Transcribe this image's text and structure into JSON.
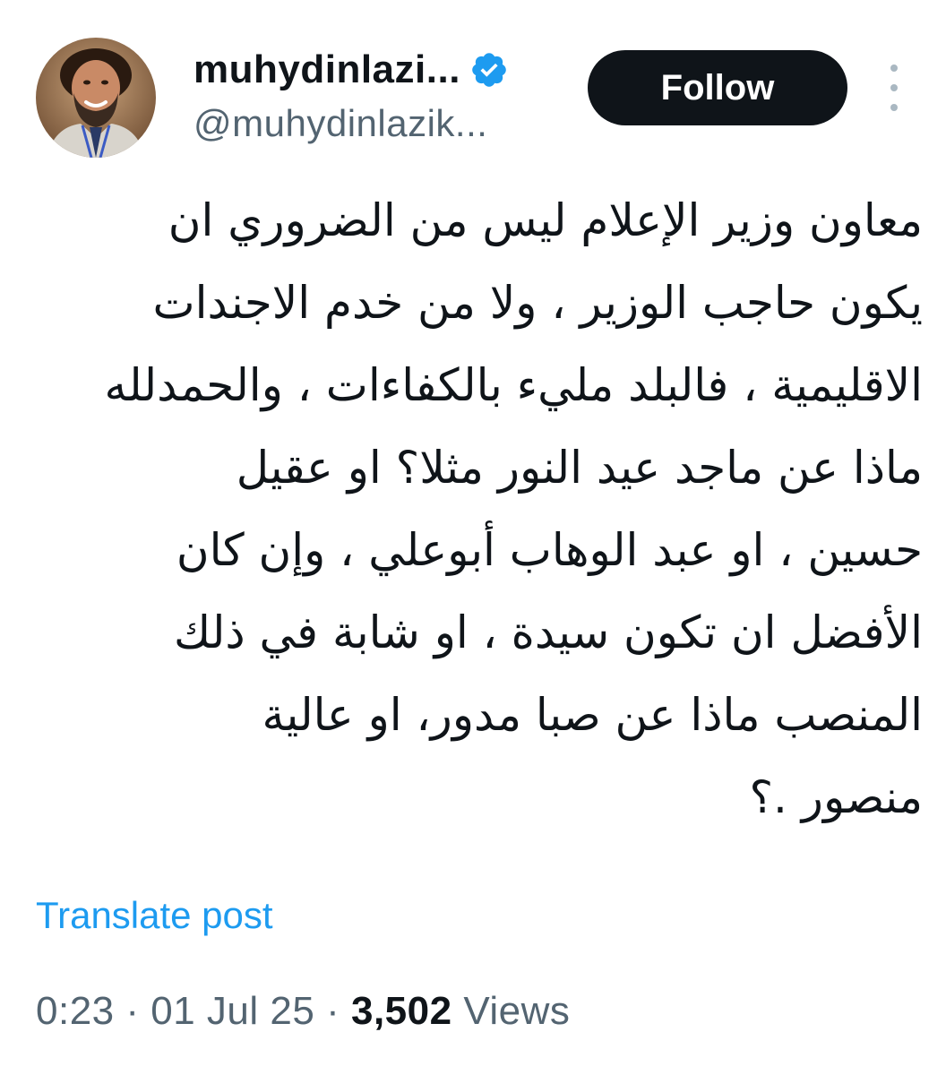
{
  "author": {
    "display_name": "muhydinlazi...",
    "handle": "@muhydinlazik...",
    "verified": true
  },
  "actions": {
    "follow_label": "Follow",
    "more_icon": "more-vertical-icon"
  },
  "tweet": {
    "lines": [
      "معاون وزير الإعلام ليس من الضروري ان",
      "يكون حاجب الوزير ، ولا من خدم الاجندات",
      "الاقليمية ، فالبلد مليء بالكفاءات ، والحمدلله",
      "ماذا عن ماجد عيد النور مثلا؟ او عقيل",
      "حسين ، او عبد الوهاب أبوعلي ، وإن كان",
      "الأفضل ان تكون سيدة ، او شابة في ذلك",
      "المنصب ماذا عن صبا مدور،  او عالية",
      "منصور .؟"
    ],
    "translate_label": "Translate post"
  },
  "meta": {
    "time": "0:23",
    "separator": "·",
    "date": "01 Jul 25",
    "views_count": "3,502",
    "views_label": "Views"
  },
  "colors": {
    "verified": "#1d9bf0",
    "link": "#1d9bf0",
    "muted": "#536471",
    "button_bg": "#0f1419"
  }
}
